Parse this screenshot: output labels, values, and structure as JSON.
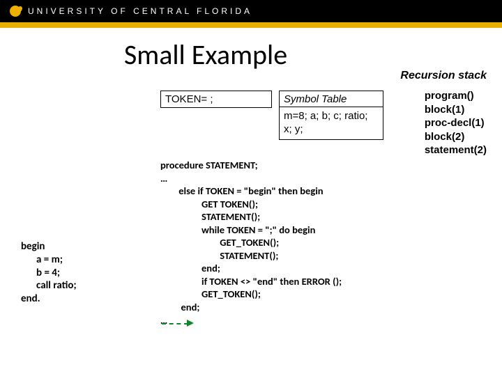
{
  "header": {
    "brand": "UNIVERSITY OF CENTRAL FLORIDA"
  },
  "title": "Small Example",
  "token_box": "TOKEN= ;",
  "symbol_table": {
    "heading": "Symbol Table",
    "values": "m=8; a; b; c; ratio; x; y;"
  },
  "recursion": {
    "heading": "Recursion stack",
    "items": [
      "program()",
      "block(1)",
      "proc-decl(1)",
      "block(2)",
      "statement(2)"
    ]
  },
  "left_code": {
    "l0": "begin",
    "l1": "a = m;",
    "l2": "b = 4;",
    "l3": "call ratio;",
    "l4": "end."
  },
  "proc_code": "procedure STATEMENT;\n…\n        else if TOKEN = \"begin\" then begin\n                  GET TOKEN();\n                  STATEMENT();\n                  while TOKEN = \";\" do begin\n                          GET_TOKEN();\n                          STATEMENT();\n                  end;\n                  if TOKEN <> \"end\" then ERROR ();\n                  GET_TOKEN();\n         end;\n…"
}
